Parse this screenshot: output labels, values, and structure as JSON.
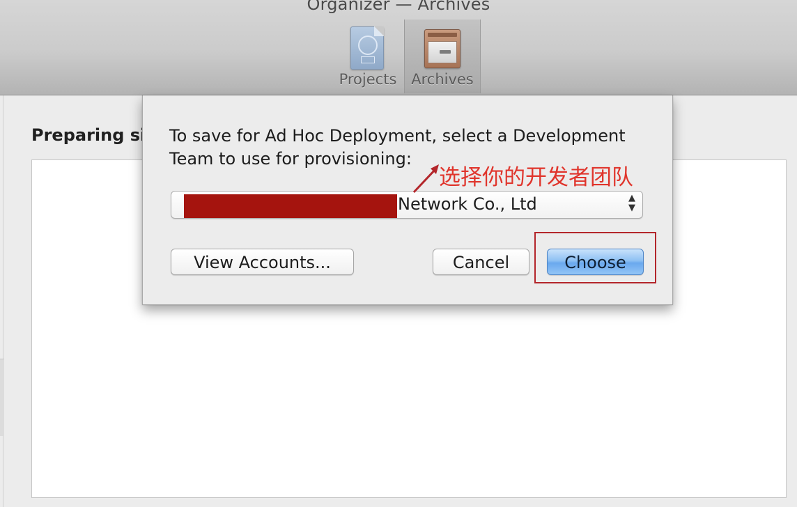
{
  "window": {
    "title": "Organizer — Archives"
  },
  "toolbar": {
    "items": [
      {
        "label": "Projects",
        "icon": "xcode-project-document-icon",
        "selected": false
      },
      {
        "label": "Archives",
        "icon": "archive-cabinet-icon",
        "selected": true
      }
    ]
  },
  "background": {
    "heading": "Preparing si"
  },
  "sheet": {
    "message": "To save for Ad Hoc Deployment, select a Development Team to use for provisioning:",
    "team_select": {
      "value": "Network Co., Ltd",
      "redacted": true,
      "arrows": "▲▼"
    },
    "buttons": {
      "view_accounts": "View Accounts...",
      "cancel": "Cancel",
      "choose": "Choose"
    }
  },
  "annotation": {
    "text": "选择你的开发者团队",
    "color": "#e0352c"
  },
  "colors": {
    "redaction": "#a5140e",
    "default_button": "#6aa8ee",
    "highlight_border": "#b3262b"
  }
}
